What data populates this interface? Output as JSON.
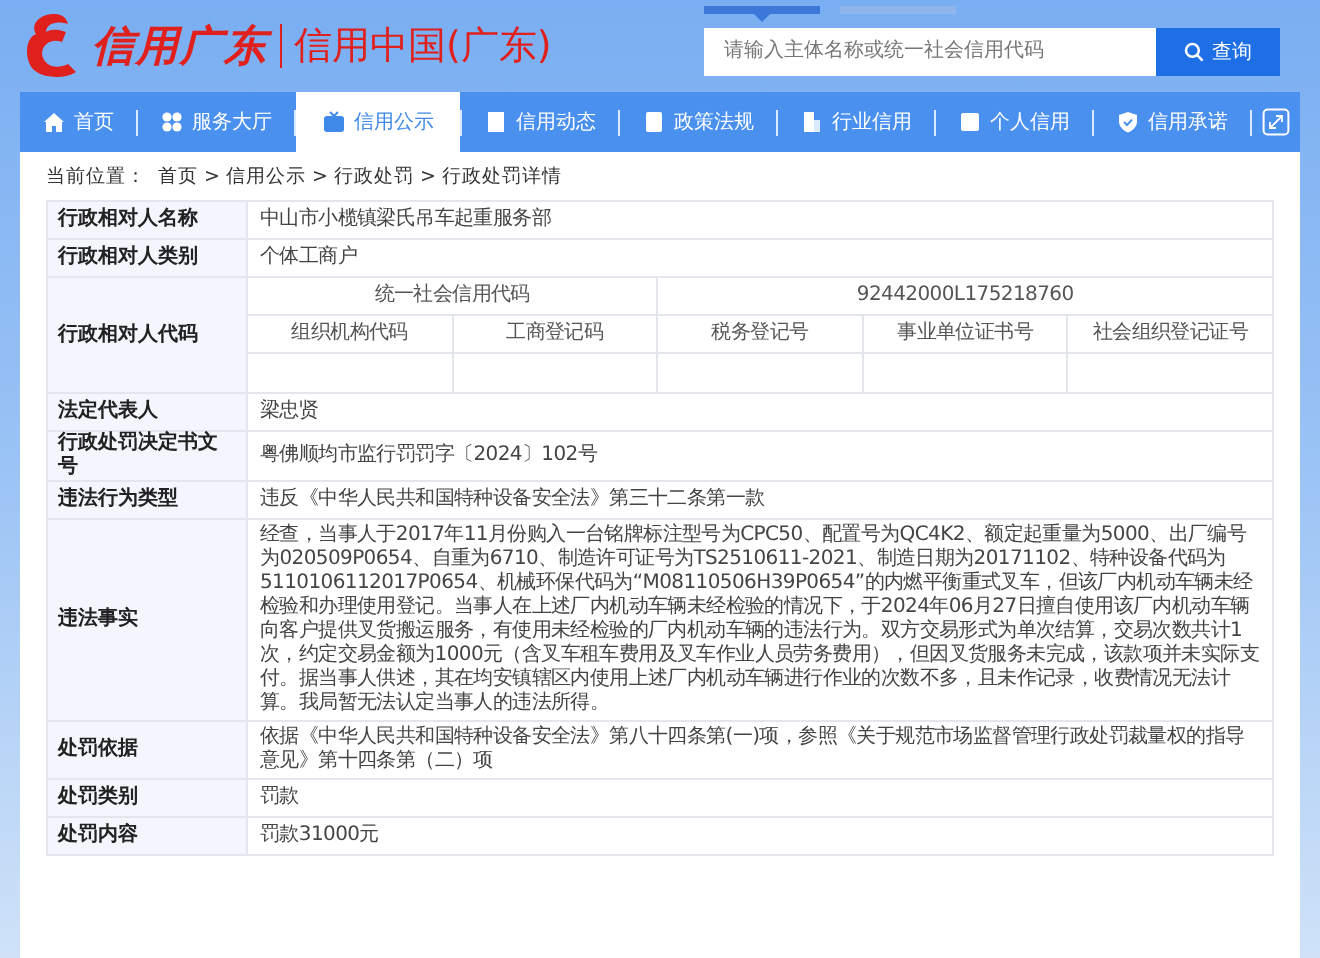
{
  "header": {
    "logo_text": "信用广东",
    "site_title": "信用中国(广东)",
    "search_tabs": [
      {
        "selected": true
      },
      {
        "selected": false
      }
    ],
    "search": {
      "placeholder": "请输入主体名称或统一社会信用代码",
      "button": "查询"
    }
  },
  "nav": [
    {
      "label": "首页",
      "selected": false
    },
    {
      "label": "服务大厅",
      "selected": false
    },
    {
      "label": "信用公示",
      "selected": true
    },
    {
      "label": "信用动态",
      "selected": false
    },
    {
      "label": "政策法规",
      "selected": false
    },
    {
      "label": "行业信用",
      "selected": false
    },
    {
      "label": "个人信用",
      "selected": false
    },
    {
      "label": "信用承诺",
      "selected": false
    }
  ],
  "breadcrumb": {
    "label": "当前位置：",
    "items": [
      "首页",
      "信用公示",
      "行政处罚",
      "行政处罚详情"
    ],
    "separator": ">"
  },
  "table": {
    "rows": [
      {
        "kind": "text",
        "label": "行政相对人名称",
        "value": "中山市小榄镇梁氏吊车起重服务部"
      },
      {
        "kind": "text",
        "label": "行政相对人类别",
        "value": "个体工商户"
      },
      {
        "kind": "codes",
        "label": "行政相对人代码",
        "code_label": "统一社会信用代码",
        "code_value": "92442000L175218760",
        "columns": [
          "组织机构代码",
          "工商登记码",
          "税务登记号",
          "事业单位证书号",
          "社会组织登记证号"
        ]
      },
      {
        "kind": "text",
        "label": "法定代表人",
        "value": "梁忠贤"
      },
      {
        "kind": "text",
        "label": "行政处罚决定书文号",
        "value": "粤佛顺均市监行罚罚字〔2024〕102号"
      },
      {
        "kind": "text",
        "label": "违法行为类型",
        "value": "违反《中华人民共和国特种设备安全法》第三十二条第一款"
      },
      {
        "kind": "text",
        "label": "违法事实",
        "value": "经查，当事人于2017年11月份购入一台铭牌标注型号为CPC50、配置号为QC4K2、额定起重量为5000、出厂编号为020509P0654、自重为6710、制造许可证号为TS2510611-2021、制造日期为20171102、特种设备代码为5110106112017P0654、机械环保代码为“M08110506H39P0654”的内燃平衡重式叉车，但该厂内机动车辆未经检验和办理使用登记。当事人在上述厂内机动车辆未经检验的情况下，于2024年06月27日擅自使用该厂内机动车辆向客户提供叉货搬运服务，有使用未经检验的厂内机动车辆的违法行为。双方交易形式为单次结算，交易次数共计1次，约定交易金额为1000元（含叉车租车费用及叉车作业人员劳务费用），但因叉货服务未完成，该款项并未实际支付。据当事人供述，其在均安镇辖区内使用上述厂内机动车辆进行作业的次数不多，且未作记录，收费情况无法计算。我局暂无法认定当事人的违法所得。"
      },
      {
        "kind": "text",
        "label": "处罚依据",
        "value": "依据《中华人民共和国特种设备安全法》第八十四条第(一)项，参照《关于规范市场监督管理行政处罚裁量权的指导意见》第十四条第（二）项"
      },
      {
        "kind": "text",
        "label": "处罚类别",
        "value": "罚款"
      },
      {
        "kind": "text",
        "label": "处罚内容",
        "value": "罚款31000元"
      }
    ]
  }
}
